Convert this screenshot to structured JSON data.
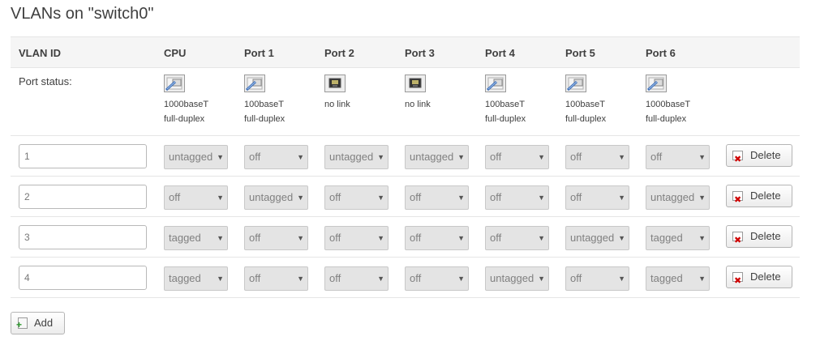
{
  "page": {
    "title": "VLANs on \"switch0\""
  },
  "table": {
    "headers": [
      "VLAN ID",
      "CPU",
      "Port 1",
      "Port 2",
      "Port 3",
      "Port 4",
      "Port 5",
      "Port 6"
    ],
    "port_status": {
      "label": "Port status:",
      "ports": [
        {
          "icon": "ethernet-port-connected-icon",
          "speed": "1000baseT",
          "duplex": "full-duplex"
        },
        {
          "icon": "ethernet-port-connected-icon",
          "speed": "100baseT",
          "duplex": "full-duplex"
        },
        {
          "icon": "ethernet-port-disconnected-icon",
          "speed": "no link",
          "duplex": ""
        },
        {
          "icon": "ethernet-port-disconnected-icon",
          "speed": "no link",
          "duplex": ""
        },
        {
          "icon": "ethernet-port-connected-icon",
          "speed": "100baseT",
          "duplex": "full-duplex"
        },
        {
          "icon": "ethernet-port-connected-icon",
          "speed": "100baseT",
          "duplex": "full-duplex"
        },
        {
          "icon": "ethernet-port-connected-icon",
          "speed": "1000baseT",
          "duplex": "full-duplex"
        }
      ]
    },
    "vlans": [
      {
        "id": "1",
        "ports": [
          "untagged",
          "off",
          "untagged",
          "untagged",
          "off",
          "off",
          "off"
        ],
        "delete_label": "Delete"
      },
      {
        "id": "2",
        "ports": [
          "off",
          "untagged",
          "off",
          "off",
          "off",
          "off",
          "untagged"
        ],
        "delete_label": "Delete"
      },
      {
        "id": "3",
        "ports": [
          "tagged",
          "off",
          "off",
          "off",
          "off",
          "untagged",
          "tagged"
        ],
        "delete_label": "Delete"
      },
      {
        "id": "4",
        "ports": [
          "tagged",
          "off",
          "off",
          "off",
          "untagged",
          "off",
          "tagged"
        ],
        "delete_label": "Delete"
      }
    ]
  },
  "add_button": {
    "label": "Add",
    "icon": "add-icon"
  },
  "colors": {
    "header_bg": "#f5f5f5",
    "row_border": "#e5e5e5",
    "select_bg": "#e4e4e4",
    "delete_icon": "#d00000",
    "add_icon": "#2e9a2e"
  }
}
